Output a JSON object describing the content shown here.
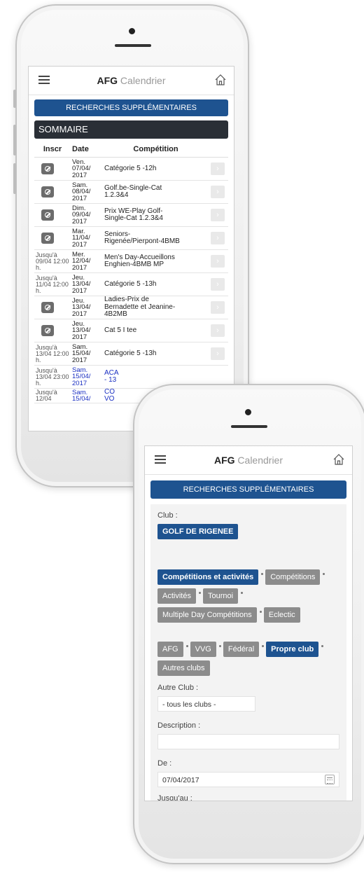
{
  "app": {
    "title_bold": "AFG",
    "title_light": "Calendrier"
  },
  "icons": {
    "menu": "hamburger-menu-icon",
    "home": "home-icon",
    "register": "no-entry-icon",
    "go": "chevron-right-icon",
    "calendar": "calendar-icon"
  },
  "colors": {
    "accent": "#1e5390",
    "dark_header": "#2a2f36",
    "chip_inactive": "#8c8c8c",
    "link_blue": "#1a2fc2"
  },
  "screen1": {
    "search_button": "RECHERCHES SUPPLÉMENTAIRES",
    "section_title": "SOMMAIRE",
    "columns": [
      "Inscr",
      "Date",
      "Compétition"
    ],
    "rows": [
      {
        "inscr": "",
        "date": [
          "Ven.",
          "07/04/",
          "2017"
        ],
        "competition": [
          "Catégorie 5 -12h"
        ]
      },
      {
        "inscr": "",
        "date": [
          "Sam.",
          "08/04/",
          "2017"
        ],
        "competition": [
          "Golf.be-Single-Cat",
          "1.2.3&4"
        ]
      },
      {
        "inscr": "",
        "date": [
          "Dim.",
          "09/04/",
          "2017"
        ],
        "competition": [
          "Prix WE-Play Golf-",
          "Single-Cat 1.2.3&4"
        ]
      },
      {
        "inscr": "",
        "date": [
          "Mar.",
          "11/04/",
          "2017"
        ],
        "competition": [
          "Seniors-",
          "Rigenée/Pierpont-4BMB"
        ]
      },
      {
        "inscr": "Jusqu'à 09/04 12:00 h.",
        "date": [
          "Mer.",
          "12/04/",
          "2017"
        ],
        "competition": [
          "Men's Day-Accueillons",
          "Enghien-4BMB MP"
        ]
      },
      {
        "inscr": "Jusqu'à 11/04 12:00 h.",
        "date": [
          "Jeu.",
          "13/04/",
          "2017"
        ],
        "competition": [
          "Catégorie 5 -13h"
        ]
      },
      {
        "inscr": "",
        "date": [
          "Jeu.",
          "13/04/",
          "2017"
        ],
        "competition": [
          "Ladies-Prix de",
          "Bernadette et Jeanine-",
          "4B2MB"
        ]
      },
      {
        "inscr": "",
        "date": [
          "Jeu.",
          "13/04/",
          "2017"
        ],
        "competition": [
          "Cat 5 I tee"
        ]
      },
      {
        "inscr": "Jusqu'à 13/04 12:00 h.",
        "date": [
          "Sam.",
          "15/04/",
          "2017"
        ],
        "competition": [
          "Catégorie 5 -13h"
        ]
      },
      {
        "inscr": "Jusqu'à 13/04 23:00 h.",
        "date": [
          "Sam.",
          "15/04/",
          "2017"
        ],
        "competition": [
          "ACA",
          "- 13"
        ]
      },
      {
        "inscr": "Jusqu'à 12/04",
        "date": [
          "Sam.",
          "15/04/"
        ],
        "competition": [
          "CO",
          "VO"
        ]
      }
    ]
  },
  "screen2": {
    "search_button": "RECHERCHES SUPPLÉMENTAIRES",
    "club_label": "Club :",
    "club_value": "GOLF DE RIGENEE",
    "type_filters": [
      "Compétitions et activités",
      "Compétitions",
      "Activités",
      "Tournoi",
      "Multiple Day Compétitions",
      "Eclectic"
    ],
    "type_selected": "Compétitions et activités",
    "org_filters": [
      "AFG",
      "VVG",
      "Fédéral",
      "Propre club",
      "Autres clubs"
    ],
    "org_selected": "Propre club",
    "other_club_label": "Autre Club :",
    "other_club_value": "- tous les clubs -",
    "description_label": "Description :",
    "description_value": "",
    "from_label": "De :",
    "from_value": "07/04/2017",
    "to_label": "Jusqu'au :"
  }
}
